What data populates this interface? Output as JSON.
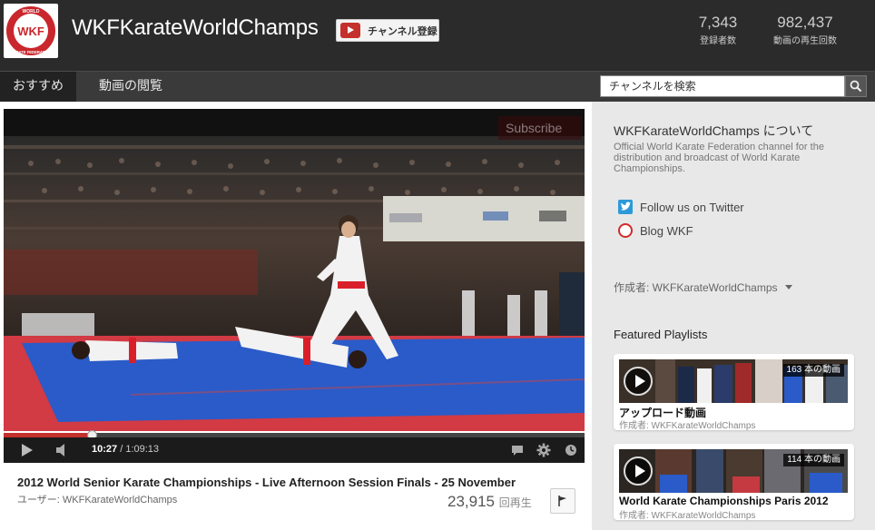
{
  "header": {
    "channel_title": "WKFKarateWorldChamps",
    "subscribe_label": "チャンネル登録",
    "subscribers": {
      "value": "7,343",
      "label": "登録者数"
    },
    "video_views": {
      "value": "982,437",
      "label": "動画の再生回数"
    },
    "logo_text": [
      "WORLD",
      "WKF",
      "KARATE FEDERATION"
    ]
  },
  "nav": {
    "tabs": [
      {
        "label": "おすすめ",
        "active": true
      },
      {
        "label": "動画の閲覧",
        "active": false
      }
    ],
    "search_placeholder": "チャンネルを検索"
  },
  "player": {
    "overlay_text": "Subscribe",
    "current_time": "10:27",
    "duration": "1:09:13",
    "progress_fraction": 0.151,
    "title": "2012 World Senior Karate Championships - Live Afternoon Session Finals - 25 November",
    "uploader": "ユーザー: WKFKarateWorldChamps",
    "views": "23,915",
    "views_unit": "回再生"
  },
  "sidebar": {
    "about_title": "WKFKarateWorldChamps について",
    "about_desc": "Official World Karate Federation channel for the distribution and broadcast of World Karate Championships.",
    "links": [
      {
        "label": "Follow us on Twitter",
        "icon": "twitter-icon"
      },
      {
        "label": "Blog WKF",
        "icon": "wkf-blog-icon"
      }
    ],
    "author": "作成者: WKFKarateWorldChamps",
    "featured_title": "Featured Playlists",
    "playlists": [
      {
        "count": "163 本の動画",
        "name": "アップロード動画",
        "author": "作成者: WKFKarateWorldChamps"
      },
      {
        "count": "114 本の動画",
        "name": "World Karate Championships Paris 2012",
        "author": "作成者: WKFKarateWorldChamps"
      }
    ]
  },
  "colors": {
    "header_bg": "#2b2b2b",
    "nav_bg": "#3a3a3a",
    "accent_red": "#c4302b",
    "sidebar_bg": "#e8e8e8"
  }
}
